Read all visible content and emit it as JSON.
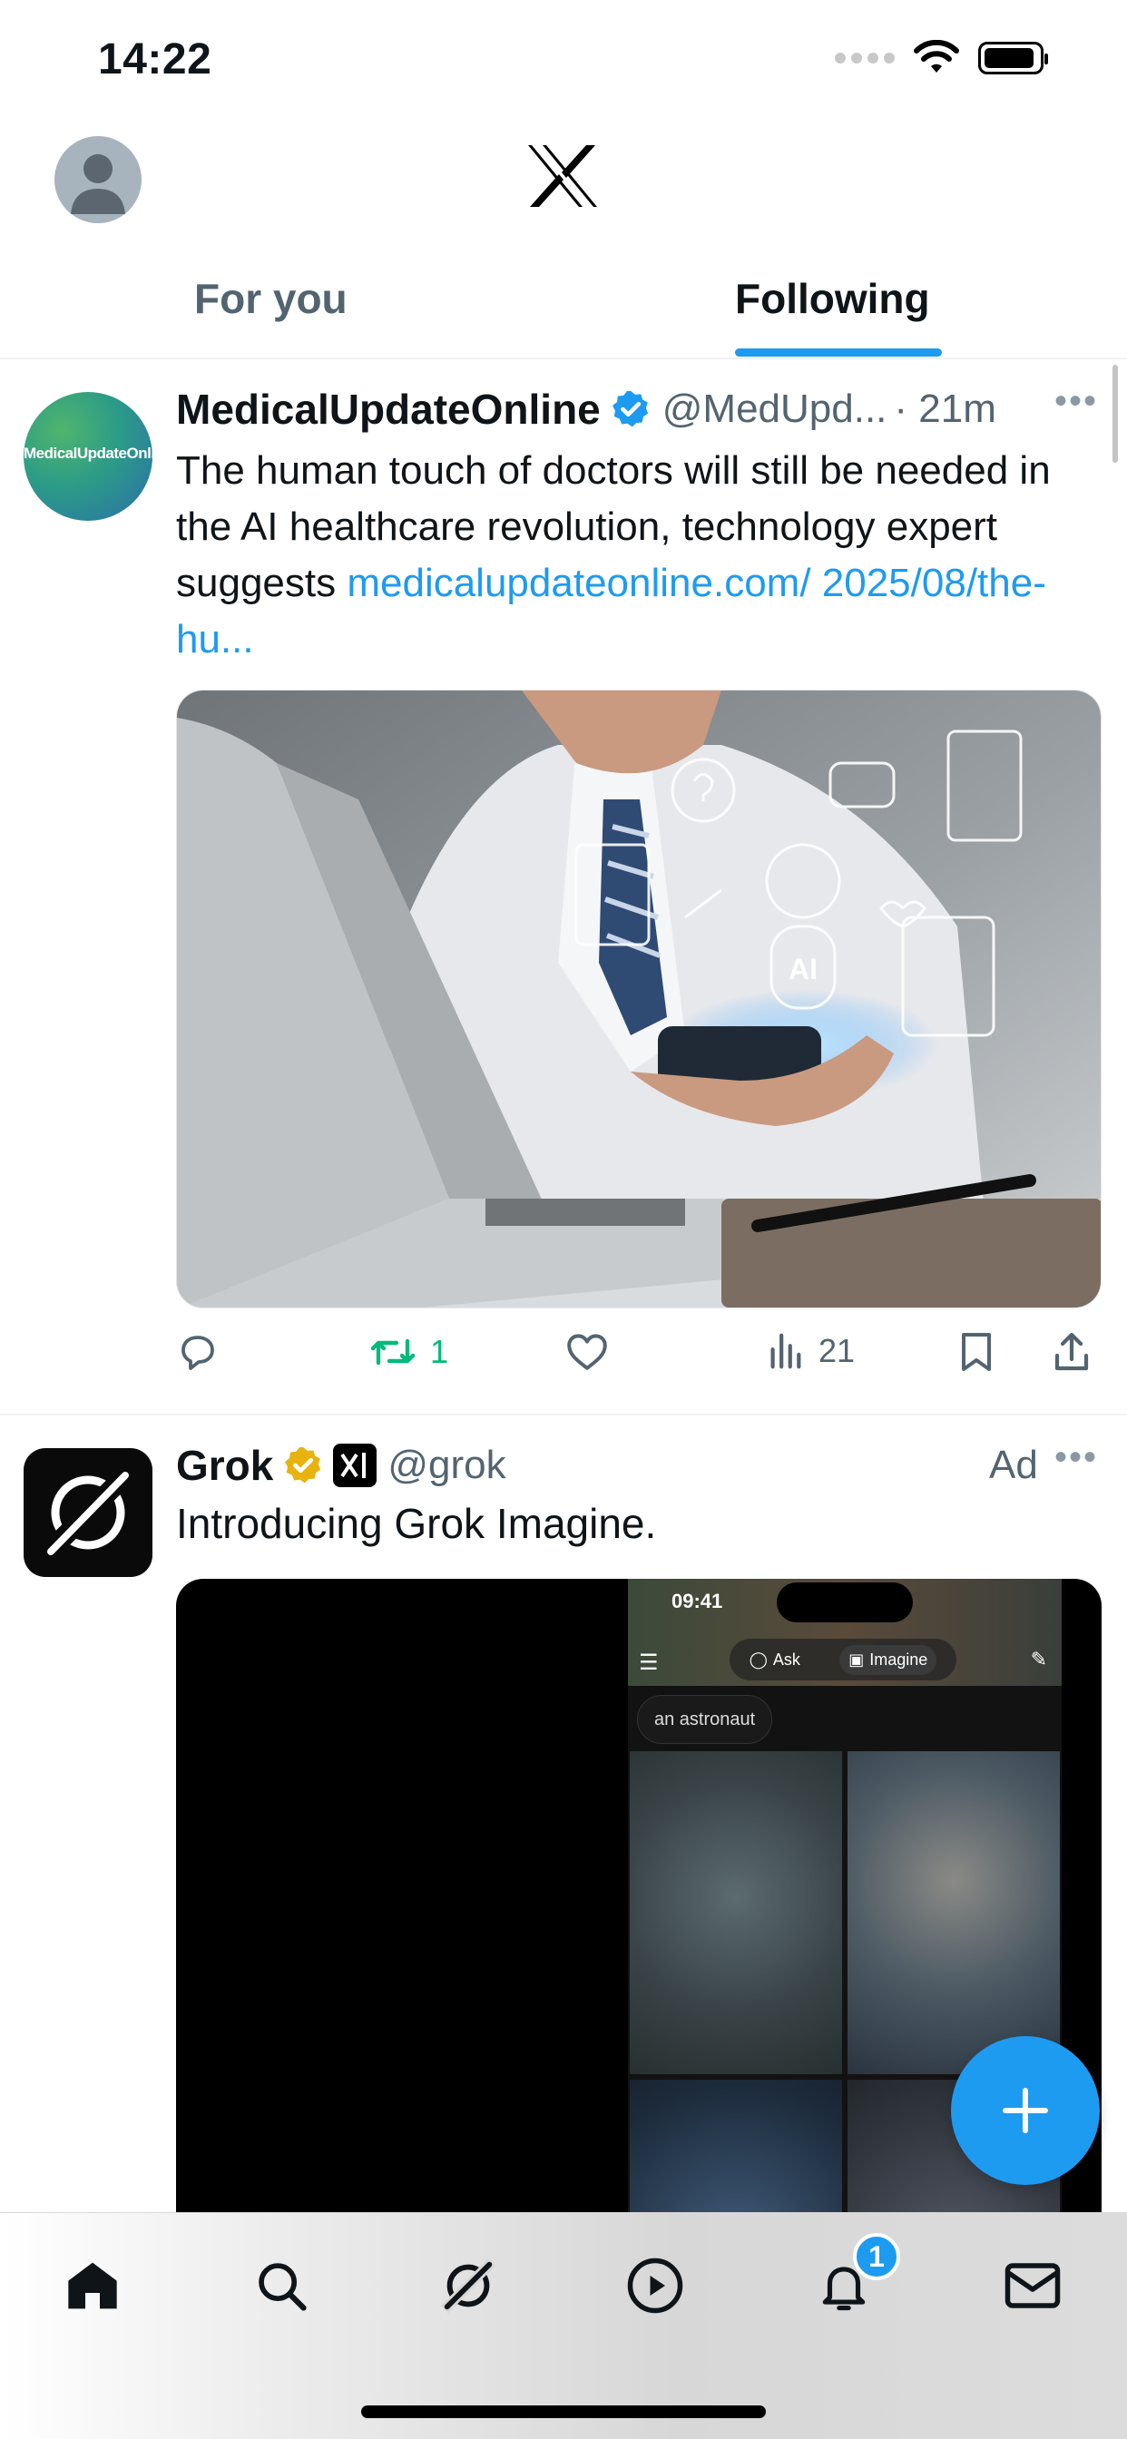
{
  "status_bar": {
    "time": "14:22"
  },
  "header": {
    "logo": "x-logo-icon",
    "tabs": [
      {
        "label": "For you",
        "active": false
      },
      {
        "label": "Following",
        "active": true
      }
    ]
  },
  "posts": [
    {
      "display_name": "MedicalUpdateOnline",
      "avatar_text": "MedicalUpdateOnline",
      "verified": "blue",
      "handle": "@MedUpd...",
      "time": "· 21m",
      "text": "The human touch of doctors will still be needed in the AI healthcare revolution, technology expert suggests ",
      "link": "medicalupdateonline.com/ 2025/08/the-hu...",
      "image_overlay_label": "AI",
      "actions": {
        "reply_count": "",
        "repost_count": "1",
        "like_count": "",
        "views_count": "21"
      }
    },
    {
      "display_name": "Grok",
      "verified": "gold",
      "affiliate_badge": "xai-icon",
      "handle": "@grok",
      "ad_label": "Ad",
      "text": "Introducing Grok Imagine.",
      "media": {
        "phone_time": "09:41",
        "tab_ask": "Ask",
        "tab_imagine": "Imagine",
        "prompt_chip": "an astronaut"
      }
    }
  ],
  "bottom_nav": {
    "items": [
      "home-icon",
      "search-icon",
      "grok-icon",
      "video-icon",
      "notifications-icon",
      "messages-icon"
    ],
    "notification_badge": "1"
  },
  "colors": {
    "accent": "#1d9bf0",
    "repost_green": "#00ba7c",
    "gold_badge": "#f4b400",
    "text_primary": "#0f1419",
    "text_secondary": "#536471"
  }
}
